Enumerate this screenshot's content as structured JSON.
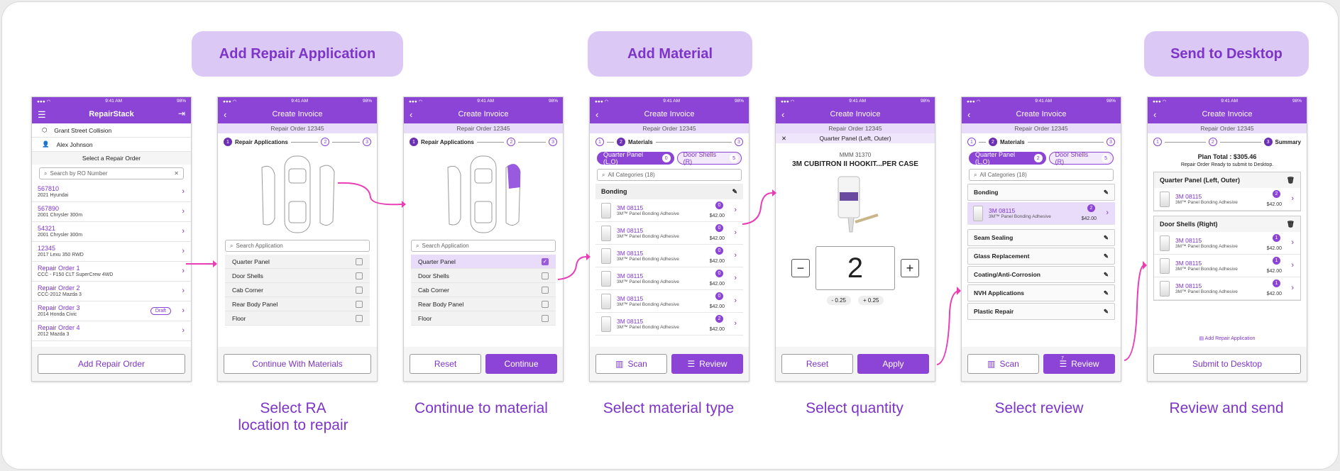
{
  "pills": {
    "add_ra": "Add Repair Application",
    "add_material": "Add Material",
    "send": "Send to Desktop"
  },
  "captions": [
    "Select RA",
    "location to repair",
    "Continue to material",
    "Select material type",
    "Select quantity",
    "Select review",
    "Review and send"
  ],
  "status": {
    "time": "9:41 AM",
    "battery": "98%"
  },
  "s1": {
    "title": "RepairStack",
    "shop": "Grant Street Collision",
    "user": "Alex Johnson",
    "select": "Select a Repair Order",
    "search": "Search by RO Number",
    "items": [
      {
        "t": "567810",
        "s": "2021 Hyundai"
      },
      {
        "t": "567890",
        "s": "2001 Chrysler 300m"
      },
      {
        "t": "54321",
        "s": "2001 Chrysler 300m"
      },
      {
        "t": "12345",
        "s": "2017 Lexu 350 RWD"
      },
      {
        "t": "Repair Order 1",
        "s": "CCC - F150 CLT SuperCrew 4WD"
      },
      {
        "t": "Repair Order 2",
        "s": "CCC-2012 Mazda 3"
      },
      {
        "t": "Repair Order 3",
        "s": "2014 Honda Civic"
      },
      {
        "t": "Repair Order 4",
        "s": "2012 Mazda 3"
      }
    ],
    "draft": "Draft",
    "button": "Add Repair Order"
  },
  "common": {
    "create": "Create Invoice",
    "ro": "Repair Order 12345",
    "ra": "Repair Applications",
    "materials": "Materials",
    "summary": "Summary",
    "search_app": "Search Application",
    "all_cat": "All Categories (18)"
  },
  "areas": [
    "Quarter Panel",
    "Door Shells",
    "Cab Corner",
    "Rear Body Panel",
    "Floor"
  ],
  "s2": {
    "button": "Continue With Materials"
  },
  "s3": {
    "reset": "Reset",
    "continue": "Continue"
  },
  "s4": {
    "tag1": "Quarter Panel (L,O)",
    "tag1n": "0",
    "tag2": "Door Shells (R)",
    "tag2n": "5",
    "bonding": "Bonding",
    "item": "3M 08115",
    "sub": "3M™ Panel Bonding Adhesive",
    "price": "$42.00",
    "badges": [
      "0",
      "0",
      "0",
      "0",
      "0",
      "2"
    ],
    "scan": "Scan",
    "review": "Review"
  },
  "s5": {
    "header": "Quarter Panel (Left, Outer)",
    "mmm": "MMM 31370",
    "product": "3M CUBITRON II HOOKIT...PER CASE",
    "qty": "2",
    "minus": "- 0.25",
    "plus": "+ 0.25",
    "reset": "Reset",
    "apply": "Apply"
  },
  "s6": {
    "tag1n": "2",
    "cats": [
      "Seam Sealing",
      "Glass Replacement",
      "Coating/Anti-Corrosion",
      "NVH Applications",
      "Plastic Repair"
    ],
    "badge": "7"
  },
  "s7": {
    "total": "Plan Total : $305.46",
    "ready": "Repair Order Ready to submit to Desktop.",
    "g1": "Quarter Panel (Left, Outer)",
    "g2": "Door Shells (Right)",
    "add": "Add Repair Application",
    "submit": "Submit to Desktop",
    "b1": "2",
    "b2": "1"
  }
}
